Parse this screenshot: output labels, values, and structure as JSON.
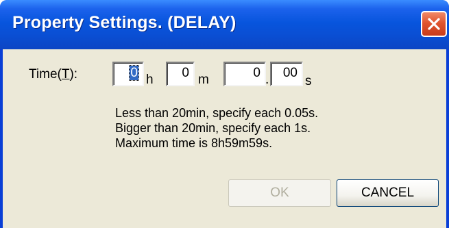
{
  "window": {
    "title": "Property Settings. (DELAY)"
  },
  "time": {
    "label_prefix": "Time(",
    "label_accel": "T",
    "label_suffix": "):",
    "hours": "0",
    "hours_unit": "h",
    "minutes": "0",
    "minutes_unit": "m",
    "seconds": "0",
    "separator": ".",
    "hundredths": "00",
    "seconds_unit": "s"
  },
  "info": {
    "line1": "Less than 20min, specify each 0.05s.",
    "line2": "Bigger than 20min, specify each 1s.",
    "line3": "Maximum time is 8h59m59s."
  },
  "buttons": {
    "ok": "OK",
    "cancel": "CANCEL"
  },
  "colors": {
    "titlebar": "#0a4fd4",
    "close": "#e0552f",
    "dialog_bg": "#ece9d8",
    "selection": "#316ac5"
  }
}
